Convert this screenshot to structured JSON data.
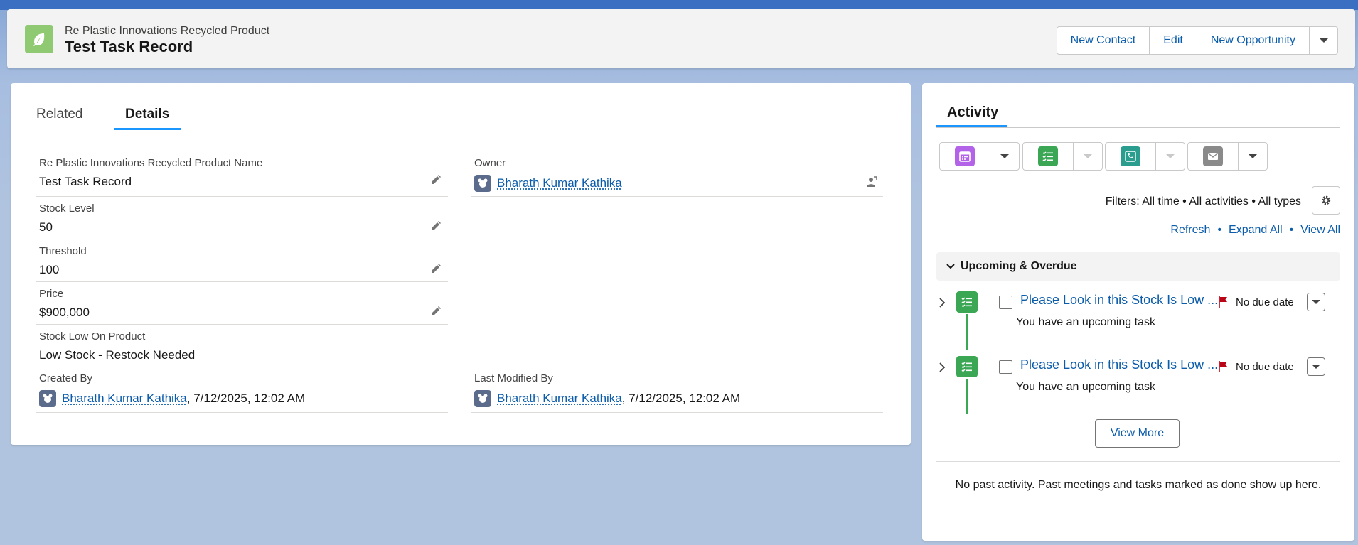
{
  "header": {
    "object_type": "Re Plastic Innovations Recycled Product",
    "record_title": "Test Task Record",
    "object_icon": "leaf-icon",
    "actions": [
      "New Contact",
      "Edit",
      "New Opportunity"
    ]
  },
  "tabs": {
    "related": "Related",
    "details": "Details"
  },
  "fields": {
    "name": {
      "label": "Re Plastic Innovations Recycled Product Name",
      "value": "Test Task Record"
    },
    "owner": {
      "label": "Owner",
      "value": "Bharath Kumar Kathika"
    },
    "stock_level": {
      "label": "Stock Level",
      "value": "50"
    },
    "threshold": {
      "label": "Threshold",
      "value": "100"
    },
    "price": {
      "label": "Price",
      "value": "$900,000"
    },
    "stock_low": {
      "label": "Stock Low On Product",
      "value": "Low Stock - Restock Needed"
    },
    "created_by": {
      "label": "Created By",
      "user": "Bharath Kumar Kathika",
      "date": ", 7/12/2025, 12:02 AM"
    },
    "modified_by": {
      "label": "Last Modified By",
      "user": "Bharath Kumar Kathika",
      "date": ", 7/12/2025, 12:02 AM"
    }
  },
  "activity": {
    "title": "Activity",
    "filters": "Filters: All time • All activities • All types",
    "links": {
      "refresh": "Refresh",
      "expand_all": "Expand All",
      "view_all": "View All",
      "separator": "•"
    },
    "section": "Upcoming & Overdue",
    "tasks": [
      {
        "title": "Please Look in this Stock Is Low ...",
        "due": "No due date",
        "subtitle": "You have an upcoming task"
      },
      {
        "title": "Please Look in this Stock Is Low ...",
        "due": "No due date",
        "subtitle": "You have an upcoming task"
      }
    ],
    "view_more": "View More",
    "past_text": "No past activity. Past meetings and tasks marked as done show up here."
  },
  "colors": {
    "brand_blue": "#0b5cab",
    "tab_accent": "#1b96ff",
    "task_green": "#3ba755",
    "event_purple": "#b263e8",
    "call_teal": "#2a9d8f",
    "email_gray": "#8a8a8a",
    "flag_red": "#ba0517"
  }
}
